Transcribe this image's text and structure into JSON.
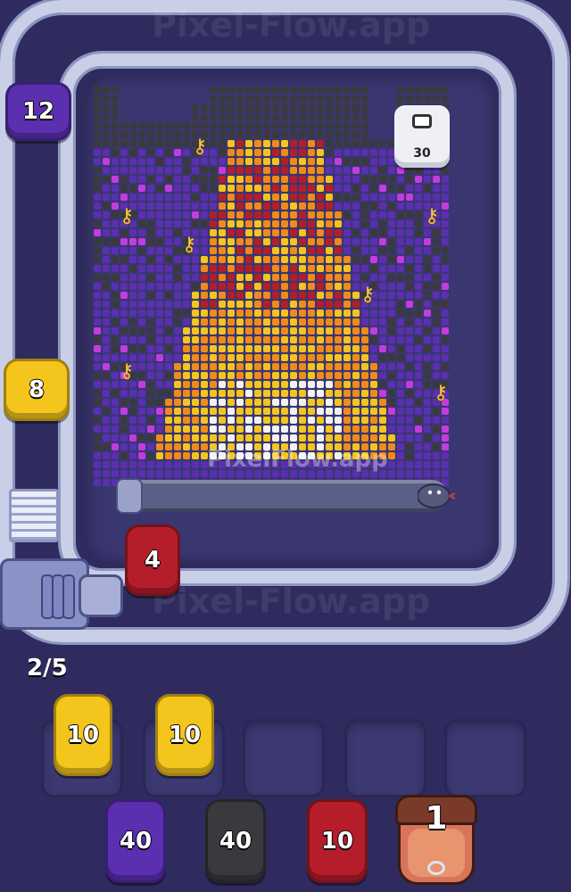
{
  "watermark": "Pixel-Flow.app",
  "board_watermark": "PixelFlow.app",
  "progress": {
    "label": "2/5"
  },
  "goal": {
    "count": "30"
  },
  "track_shooters": [
    {
      "value": "12",
      "color": "#5a2fb0"
    },
    {
      "value": "8",
      "color": "#f4c51c"
    },
    {
      "value": "4",
      "color": "#b51d2a"
    }
  ],
  "slots": [
    {
      "value": "10",
      "color": "#f4c51c"
    },
    {
      "value": "10",
      "color": "#f4c51c"
    },
    {
      "value": "",
      "color": ""
    },
    {
      "value": "",
      "color": ""
    },
    {
      "value": "",
      "color": ""
    }
  ],
  "queue": [
    {
      "value": "40",
      "color": "#5a2fb0"
    },
    {
      "value": "40",
      "color": "#3a3a3e"
    },
    {
      "value": "10",
      "color": "#b51d2a"
    },
    {
      "value": "1",
      "color": "#d9745b",
      "kind": "bull"
    }
  ],
  "palette": {
    "purple": "#5a2fb0",
    "dark": "#3a3a3e",
    "yellow": "#f4c51c",
    "orange": "#f08a19",
    "red": "#b51d2a",
    "white": "#f2f2f2",
    "magenta": "#c43be0",
    "gold": "#f7c83a"
  },
  "icons": {
    "key": "key-icon",
    "bull": "bull-icon",
    "snake": "snake-icon"
  }
}
